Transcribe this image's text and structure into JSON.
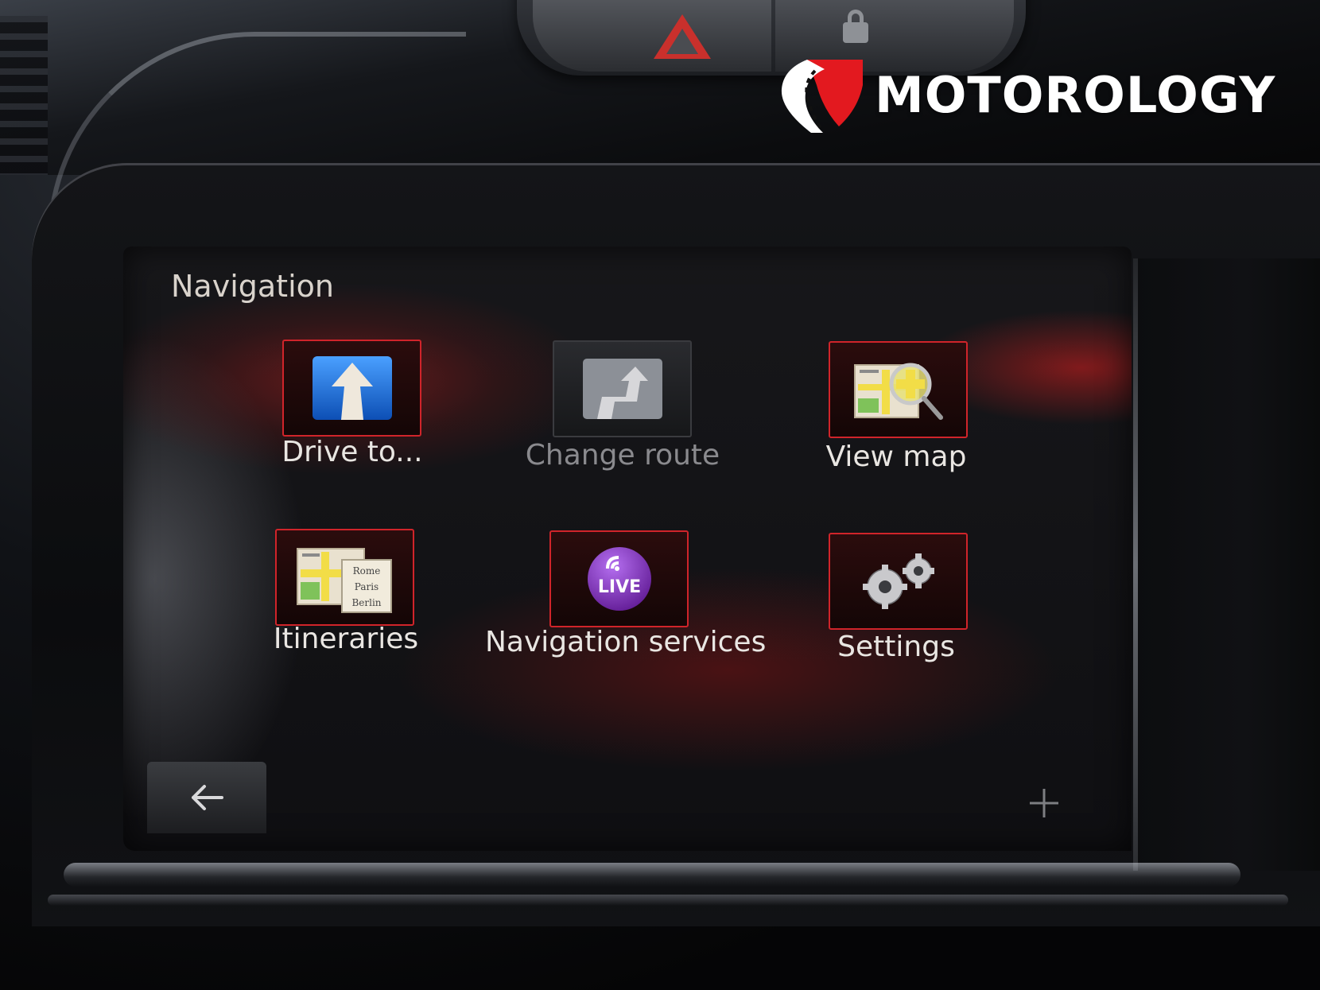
{
  "watermark": {
    "brand": "MOTOROLOGY"
  },
  "screen": {
    "title": "Navigation",
    "menu": [
      {
        "label": "Drive to...",
        "icon": "drive-to-arrow-icon",
        "enabled": true
      },
      {
        "label": "Change route",
        "icon": "change-route-icon",
        "enabled": false
      },
      {
        "label": "View map",
        "icon": "view-map-icon",
        "enabled": true
      },
      {
        "label": "Itineraries",
        "icon": "itineraries-icon",
        "enabled": true
      },
      {
        "label": "Navigation services",
        "icon": "live-services-icon",
        "enabled": true
      },
      {
        "label": "Settings",
        "icon": "settings-gears-icon",
        "enabled": true
      }
    ],
    "live_badge": "LIVE",
    "itinerary_cities": [
      "Rome",
      "Paris",
      "Berlin"
    ],
    "back_icon": "back-arrow-icon",
    "plus_icon": "plus-icon"
  },
  "colors": {
    "tile_border": "#d0242a",
    "live_purple": "#7a2bb5",
    "drive_blue": "#1f6fd6",
    "hazard_red": "#c9302c"
  }
}
